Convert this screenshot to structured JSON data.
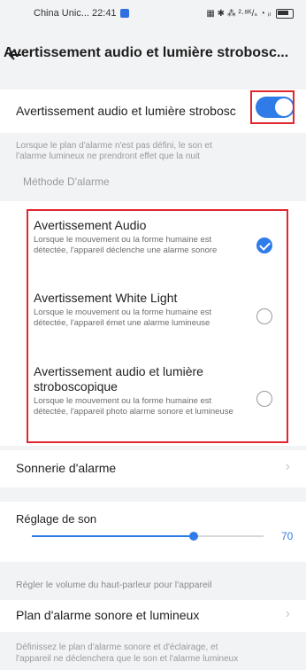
{
  "status_bar": {
    "carrier_time": "China Unic... 22:41",
    "right_text": "▦ ✱ ⁂ ²·⁸ᴷ/ₛ ◔ ᵢₗ"
  },
  "header": {
    "title": "Avertissement audio et lumière strobosc..."
  },
  "main_toggle": {
    "label": "Avertissement audio et lumière strobosc",
    "enabled": true
  },
  "notice": {
    "line1": "Lorsque le plan d'alarme n'est pas défini, le son et",
    "line2": "l'alarme lumineux ne prendront effet que la nuit"
  },
  "method_label": "Méthode D'alarme",
  "options": [
    {
      "title": "Avertissement Audio",
      "desc": "Lorsque le mouvement ou la forme humaine est détectée, l'appareil déclenche une alarme sonore",
      "selected": true
    },
    {
      "title": "Avertissement White Light",
      "desc": "Lorsque le mouvement ou la forme humaine est détectée, l'appareil émet une alarme lumineuse",
      "selected": false
    },
    {
      "title": "Avertissement audio et lumière stroboscopique",
      "desc": "Lorsque le mouvement ou la forme humaine est détectée, l'appareil photo alarme sonore et lumineuse",
      "selected": false
    }
  ],
  "ringtone": {
    "label": "Sonnerie d'alarme",
    "chevron": "›"
  },
  "volume": {
    "label": "Réglage de son",
    "value": "70",
    "fraction": 0.7,
    "help": "Régler le volume du haut-parleur pour l'appareil"
  },
  "plan": {
    "label": "Plan d'alarme sonore et lumineux",
    "chevron": "›",
    "help_line1": "Définissez le plan d'alarme sonore et d'éclairage, et",
    "help_line2": "l'appareil ne déclenchera que le son et l'alarme lumineux"
  },
  "colors": {
    "accent": "#2f7be8",
    "highlight": "#e0262e",
    "background": "#f2f3f5"
  }
}
